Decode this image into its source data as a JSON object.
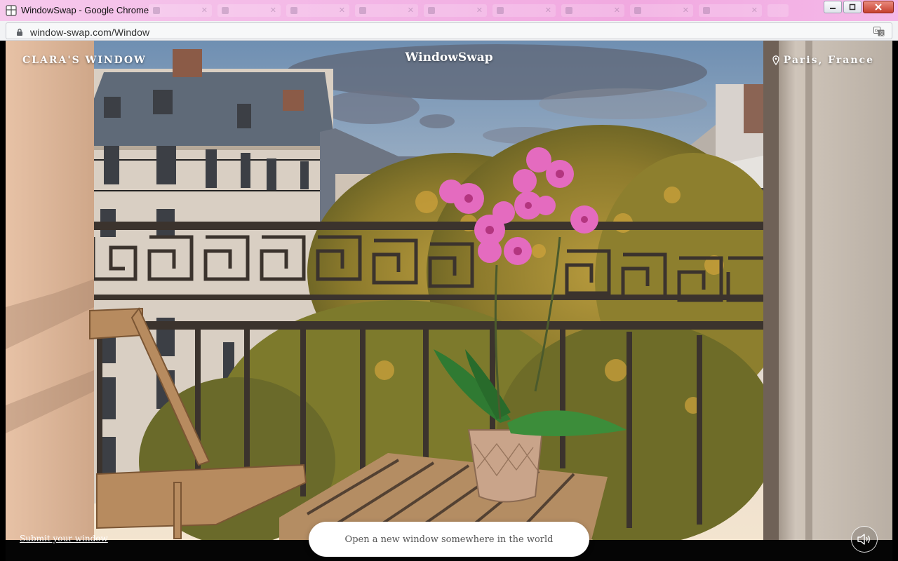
{
  "browser": {
    "window_title": "WindowSwap - Google Chrome",
    "url": "window-swap.com/Window"
  },
  "page": {
    "brand": "WindowSwap",
    "window_owner": "Clara's Window",
    "location": "Paris, France",
    "submit_link": "Submit your window",
    "open_button": "Open a new window somewhere in the world"
  },
  "colors": {
    "titlebar_accent": "#f3b6e6",
    "button_bg": "#ffffff",
    "button_text": "#555555"
  },
  "icons": [
    "browser-app-icon",
    "lock-icon",
    "translate-icon",
    "location-pin-icon",
    "speaker-icon"
  ]
}
